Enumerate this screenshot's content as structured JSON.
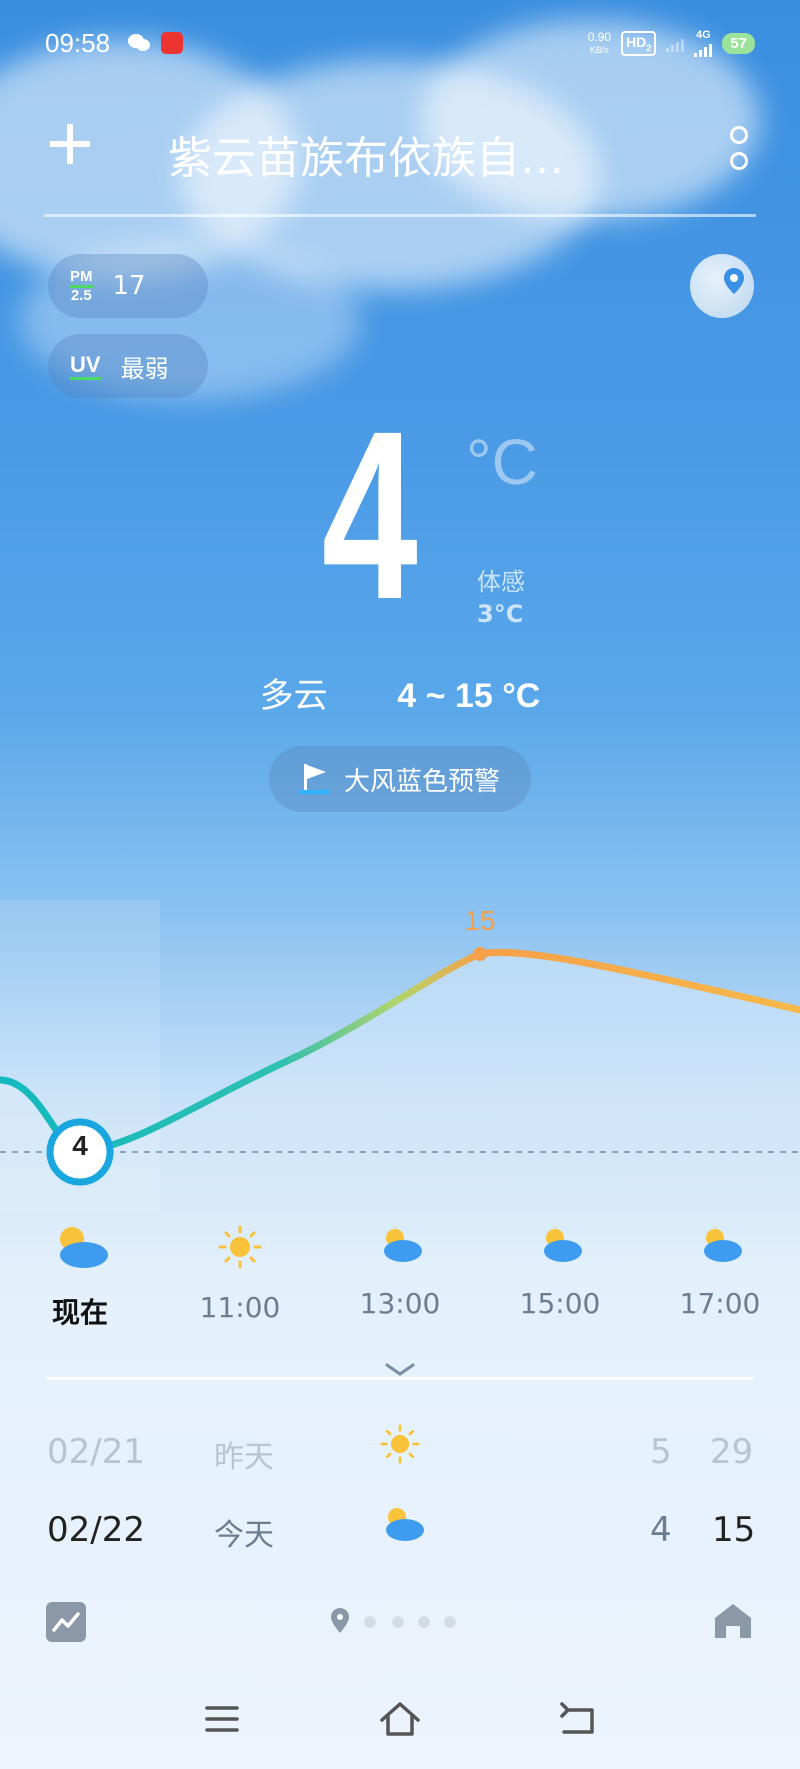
{
  "status": {
    "time": "09:58",
    "net_speed": "0.90",
    "net_unit": "KB/s",
    "hd": "HD",
    "hd_sub": "2",
    "network": "4G",
    "battery": "57"
  },
  "header": {
    "title": "紫云苗族布依族自…"
  },
  "aqi": {
    "pm_label_top": "PM",
    "pm_label_bottom": "2.5",
    "pm_value": "17",
    "uv_label": "UV",
    "uv_value": "最弱"
  },
  "current": {
    "temp": "4",
    "unit": "°C",
    "feels_label": "体感",
    "feels_value": "3°C",
    "condition": "多云",
    "range": "4 ~ 15 °C"
  },
  "alert": {
    "text": "大风蓝色预警"
  },
  "chart": {
    "now_temp": "4",
    "max_label": "15"
  },
  "hourly": [
    {
      "time": "现在",
      "icon": "partly-cloudy-icon"
    },
    {
      "time": "11:00",
      "icon": "sun-icon"
    },
    {
      "time": "13:00",
      "icon": "partly-cloudy-icon"
    },
    {
      "time": "15:00",
      "icon": "partly-cloudy-icon"
    },
    {
      "time": "17:00",
      "icon": "partly-cloudy-icon"
    }
  ],
  "daily": [
    {
      "date": "02/21",
      "day": "昨天",
      "icon": "sun-icon",
      "low": "5",
      "high": "29"
    },
    {
      "date": "02/22",
      "day": "今天",
      "icon": "partly-cloudy-icon",
      "low": "4",
      "high": "15"
    }
  ],
  "colors": {
    "accent": "#1aa7e0",
    "warm": "#f6a04a",
    "cool": "#19c2b9"
  }
}
